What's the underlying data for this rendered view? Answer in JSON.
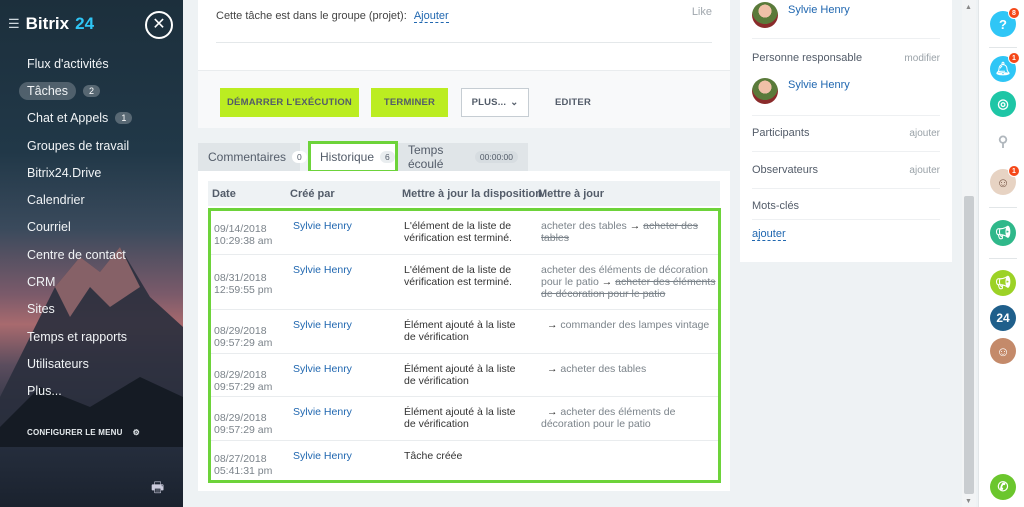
{
  "sidebar": {
    "brand_a": "Bitrix",
    "brand_b": "24",
    "items": [
      {
        "label": "Flux d'activités",
        "count": ""
      },
      {
        "label": "Tâches",
        "count": "2"
      },
      {
        "label": "Chat et Appels",
        "count": "1"
      },
      {
        "label": "Groupes de travail",
        "count": ""
      },
      {
        "label": "Bitrix24.Drive",
        "count": ""
      },
      {
        "label": "Calendrier",
        "count": ""
      },
      {
        "label": "Courriel",
        "count": ""
      },
      {
        "label": "Centre de contact",
        "count": ""
      },
      {
        "label": "CRM",
        "count": ""
      },
      {
        "label": "Sites",
        "count": ""
      },
      {
        "label": "Temps et rapports",
        "count": ""
      },
      {
        "label": "Utilisateurs",
        "count": ""
      },
      {
        "label": "Plus...",
        "count": ""
      }
    ],
    "configure_label": "CONFIGURER LE MENU"
  },
  "task": {
    "group_text": "Cette tâche est dans le groupe (projet):",
    "group_link": "Ajouter",
    "like_label": "Like"
  },
  "buttons": {
    "start": "DÉMARRER L'EXÉCUTION",
    "finish": "TERMINER",
    "more": "PLUS...",
    "edit": "EDITER"
  },
  "tabs": [
    {
      "label": "Commentaires",
      "badge": "0"
    },
    {
      "label": "Historique",
      "badge": "6"
    },
    {
      "label": "Temps écoulé",
      "badge": "00:00:00"
    }
  ],
  "history": {
    "columns": [
      "Date",
      "Créé par",
      "Mettre à jour la disposition",
      "Mettre à jour"
    ],
    "rows": [
      {
        "date": "09/14/2018",
        "time": "10:29:38 am",
        "user": "Sylvie Henry",
        "action": "L'élément de la liste de vérification est terminé.",
        "new_value": "acheter des tables",
        "old_value": "acheter des tables"
      },
      {
        "date": "08/31/2018",
        "time": "12:59:55 pm",
        "user": "Sylvie Henry",
        "action": "L'élément de la liste de vérification est terminé.",
        "new_value": "acheter des éléments de décoration pour le patio",
        "old_value": "acheter des éléments de décoration pour le patio"
      },
      {
        "date": "08/29/2018",
        "time": "09:57:29 am",
        "user": "Sylvie Henry",
        "action": "Élément ajouté à la liste de vérification",
        "new_value": "commander des lampes vintage",
        "old_value": ""
      },
      {
        "date": "08/29/2018",
        "time": "09:57:29 am",
        "user": "Sylvie Henry",
        "action": "Élément ajouté à la liste de vérification",
        "new_value": "acheter des tables",
        "old_value": ""
      },
      {
        "date": "08/29/2018",
        "time": "09:57:29 am",
        "user": "Sylvie Henry",
        "action": "Élément ajouté à la liste de vérification",
        "new_value": "acheter des éléments de décoration pour le patio",
        "old_value": ""
      },
      {
        "date": "08/27/2018",
        "time": "05:41:31 pm",
        "user": "Sylvie Henry",
        "action": "Tâche créée",
        "new_value": "",
        "old_value": ""
      }
    ],
    "arrow_glyph": "→"
  },
  "right_panel": {
    "creator_name": "Sylvie Henry",
    "responsible_label": "Personne responsable",
    "responsible_action": "modifier",
    "responsible_name": "Sylvie Henry",
    "participants_label": "Participants",
    "participants_action": "ajouter",
    "observers_label": "Observateurs",
    "observers_action": "ajouter",
    "tags_label": "Mots-clés",
    "tags_action": "ajouter"
  },
  "right_bar": {
    "help_badge": "8",
    "notif_badge": "1",
    "contacts_badge": "1",
    "b24_label": "24"
  },
  "colors": {
    "accent_green": "#bbed21",
    "highlight_green": "#6dd33a",
    "link_blue": "#2067b0",
    "badge_red": "#f54819"
  }
}
